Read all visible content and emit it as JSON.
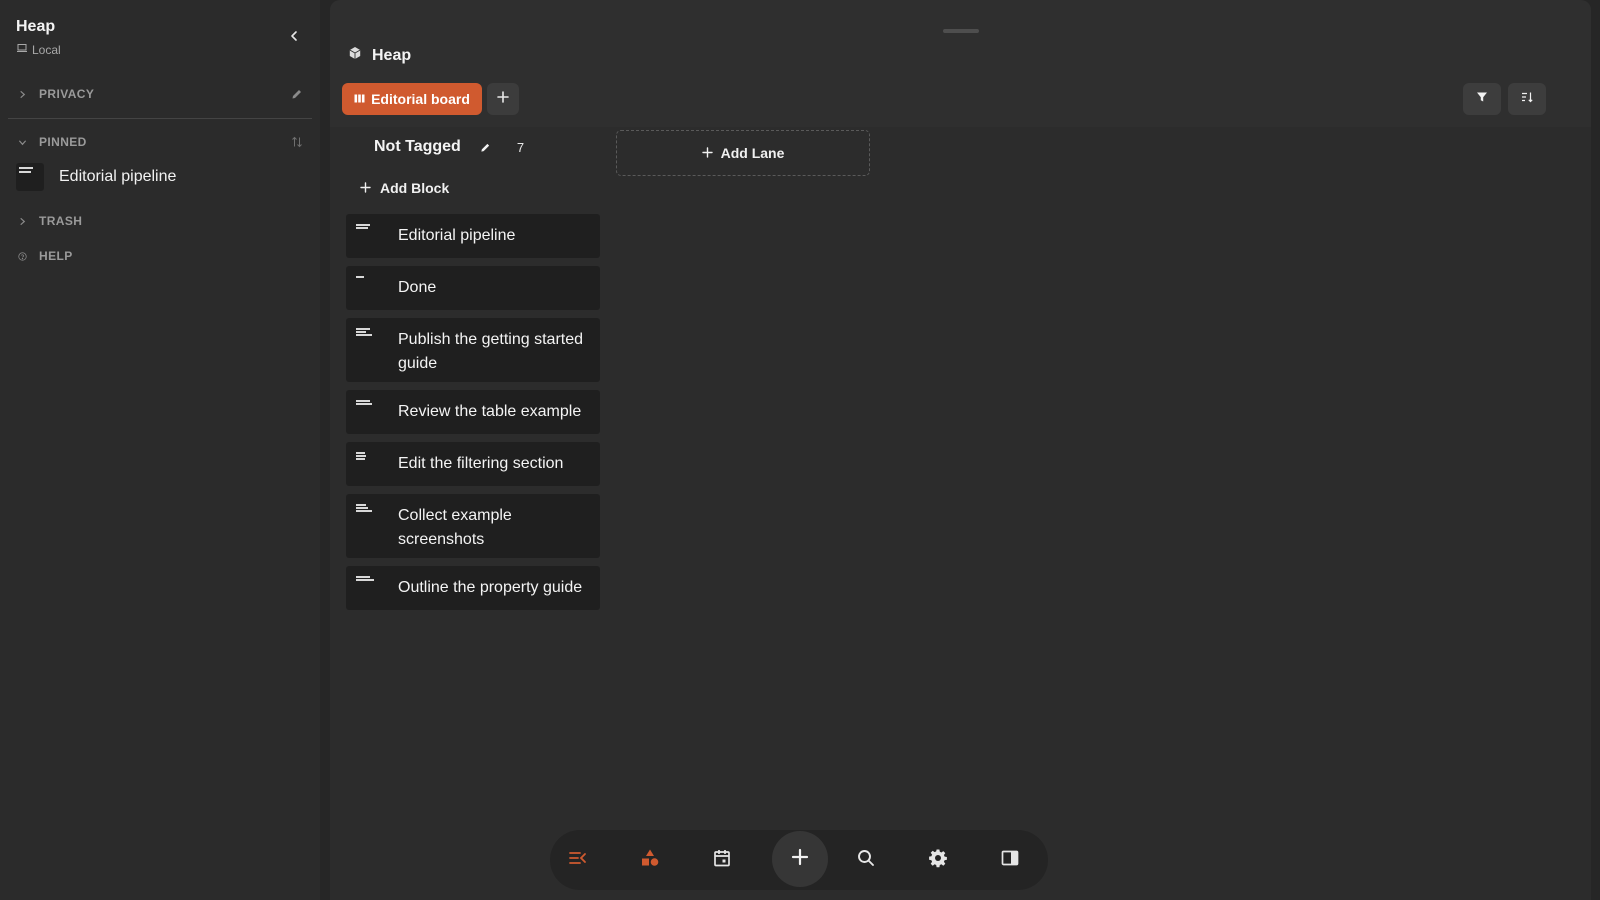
{
  "sidebar": {
    "title": "Heap",
    "subtitle": "Local",
    "sections": {
      "privacy": "PRIVACY",
      "pinned": "PINNED",
      "trash": "TRASH",
      "help": "HELP"
    },
    "pinned_items": [
      {
        "label": "Editorial pipeline"
      }
    ]
  },
  "main": {
    "title": "Heap",
    "tabs": [
      {
        "label": "Editorial board",
        "active": true
      }
    ],
    "lane": {
      "title": "Not Tagged",
      "count": "7",
      "add_block_label": "Add Block",
      "cards": [
        {
          "title": "Editorial pipeline"
        },
        {
          "title": "Done"
        },
        {
          "title": "Publish the getting started guide"
        },
        {
          "title": "Review the table example"
        },
        {
          "title": "Edit the filtering section"
        },
        {
          "title": "Collect example screenshots"
        },
        {
          "title": "Outline the property guide"
        }
      ]
    },
    "add_lane_label": "Add Lane"
  },
  "bottom_nav": {
    "items": [
      "menu-icon",
      "shapes-icon",
      "calendar-icon",
      "plus-icon",
      "search-icon",
      "gear-icon",
      "sidebar-panel-icon"
    ]
  },
  "colors": {
    "accent": "#d05a2f",
    "background": "#262626",
    "sidebar": "#2b2b2b",
    "card": "#1f1f1f"
  }
}
